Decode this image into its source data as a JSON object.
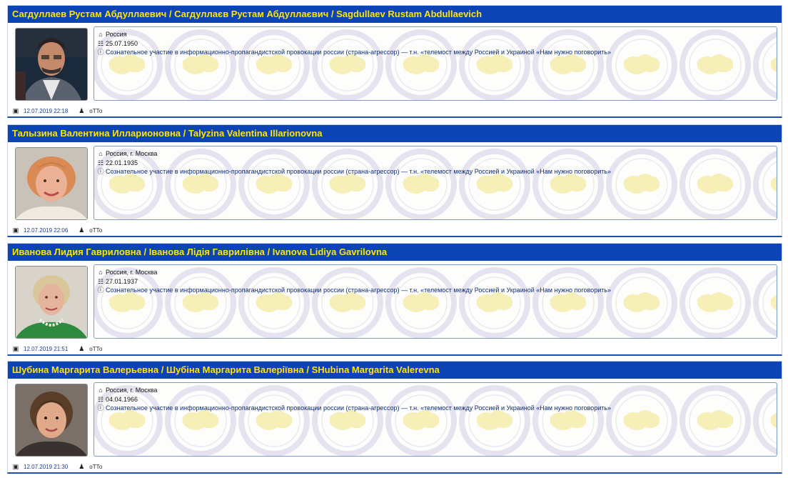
{
  "colors": {
    "header_bg": "#0d44b5",
    "header_text": "#ffe500",
    "desc_text": "#0d2e78"
  },
  "entries": [
    {
      "title": "Сагдуллаев Рустам Абдуллаевич / Сагдуллаєв Рустам Абдуллаєвич / Sagdullaev Rustam Abdullaevich",
      "country": "Россия",
      "birth_date": "25.07.1950",
      "description": "Сознательное участие в информационно-пропагандистской провокации россии (страна-агрессор) — т.н. «телемост между Россией и Украиной «Нам нужно поговорить»",
      "posted": "12.07.2019 22:18",
      "author": "оТТо"
    },
    {
      "title": "Талызина Валентина Илларионовна / Talyzina Valentina Illarionovna",
      "country": "Россия, г. Москва",
      "birth_date": "22.01.1935",
      "description": "Сознательное участие в информационно-пропагандистской провокации россии (страна-агрессор) — т.н. «телемост между Россией и Украиной «Нам нужно поговорить»",
      "posted": "12.07.2019 22:06",
      "author": "оТТо"
    },
    {
      "title": "Иванова Лидия Гавриловна / Іванова Лідія Гаврилівна / Ivanova Lidiya Gavrilovna",
      "country": "Россия, г. Москва",
      "birth_date": "27.01.1937",
      "description": "Сознательное участие в информационно-пропагандистской провокации россии (страна-агрессор) — т.н. «телемост между Россией и Украиной «Нам нужно поговорить»",
      "posted": "12.07.2019 21:51",
      "author": "оТТо"
    },
    {
      "title": "Шубина Маргарита Валерьевна / Шубіна Маргарита Валеріївна / SHubina Margarita Valerevna",
      "country": "Россия, г. Москва",
      "birth_date": "04.04.1966",
      "description": "Сознательное участие в информационно-пропагандистской провокации россии (страна-агрессор) — т.н. «телемост между Россией и Украиной «Нам нужно поговорить»",
      "posted": "12.07.2019 21:30",
      "author": "оТТо"
    }
  ]
}
